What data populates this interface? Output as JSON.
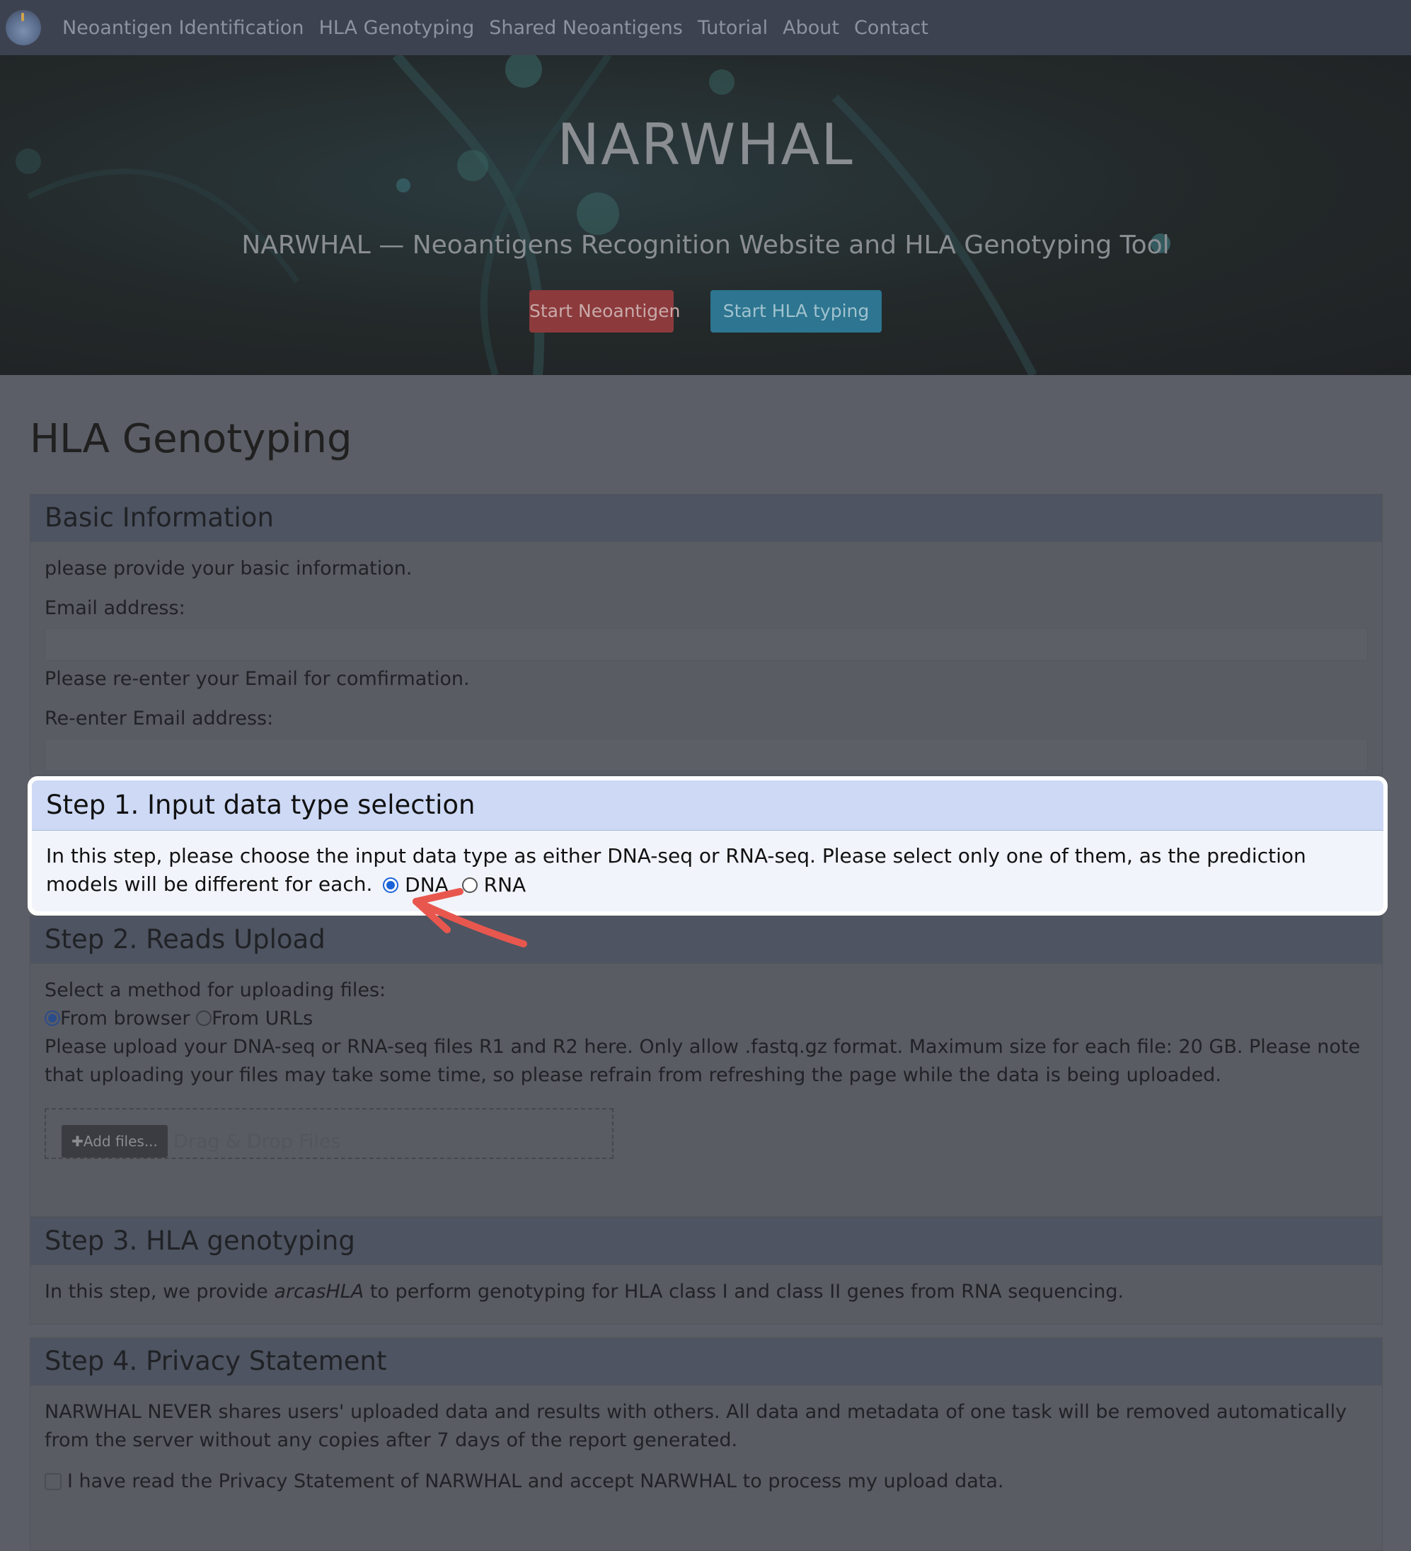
{
  "nav": {
    "items": [
      {
        "label": "Neoantigen Identification"
      },
      {
        "label": "HLA Genotyping"
      },
      {
        "label": "Shared Neoantigens"
      },
      {
        "label": "Tutorial"
      },
      {
        "label": "About"
      },
      {
        "label": "Contact"
      }
    ]
  },
  "hero": {
    "title": "NARWHAL",
    "subtitle": "NARWHAL — Neoantigens Recognition Website and HLA Genotyping Tool",
    "btn_neoantigen": "Start Neoantigen",
    "btn_hla": "Start HLA typing"
  },
  "page_title": "HLA Genotyping",
  "basic": {
    "heading": "Basic Information",
    "intro": "please provide your basic information.",
    "email_label": "Email address:",
    "confirm_note": "Please re-enter your Email for comfirmation.",
    "reenter_label": "Re-enter Email address:"
  },
  "step1": {
    "heading": "Step 1. Input data type selection",
    "text": "In this step, please choose the input data type as either DNA-seq or RNA-seq. Please select only one of them, as the prediction models will be different for each.",
    "option_dna": "DNA",
    "option_rna": "RNA",
    "selected": "DNA"
  },
  "step2": {
    "heading": "Step 2. Reads Upload",
    "method_label": "Select a method for uploading files:",
    "option_browser": "From browser",
    "option_urls": "From URLs",
    "note": "Please upload your DNA-seq or RNA-seq files R1 and R2 here. Only allow .fastq.gz format. Maximum size for each file: 20 GB. Please note that uploading your files may take some time, so please refrain from refreshing the page while the data is being uploaded.",
    "add_files": "Add files...",
    "drop_text": "Drag & Drop Files"
  },
  "step3": {
    "heading": "Step 3. HLA genotyping",
    "text_before": "In this step, we provide ",
    "tool": "arcasHLA",
    "text_after": " to perform genotyping for HLA class I and class II genes from RNA sequencing."
  },
  "step4": {
    "heading": "Step 4. Privacy Statement",
    "text": "NARWHAL NEVER shares users' uploaded data and results with others. All data and metadata of one task will be removed automatically from the server without any copies after 7 days of the report generated.",
    "checkbox_label": "I have read the Privacy Statement of NARWHAL and accept NARWHAL to process my upload data."
  },
  "colors": {
    "accent_radio": "#1a64d8",
    "step1_header": "#cdd9f5",
    "arrow": "#e8574e"
  }
}
